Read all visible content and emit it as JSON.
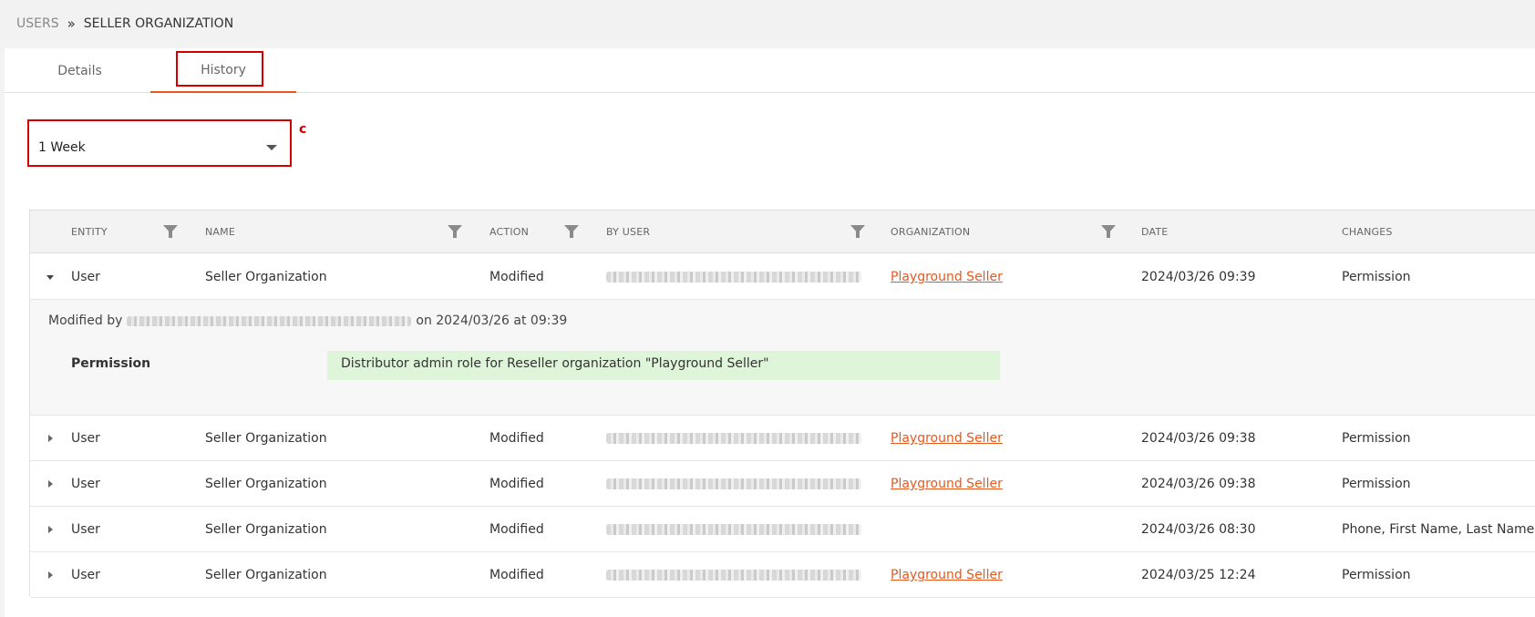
{
  "breadcrumb": {
    "root": "USERS",
    "separator": "»",
    "current": "SELLER ORGANIZATION"
  },
  "tabs": [
    {
      "label": "Details",
      "active": false
    },
    {
      "label": "History",
      "active": true
    }
  ],
  "period_select": {
    "value": "1 Week"
  },
  "annotation_label": "c",
  "grid": {
    "columns": [
      "ENTITY",
      "NAME",
      "ACTION",
      "BY USER",
      "ORGANIZATION",
      "DATE",
      "CHANGES"
    ],
    "rows": [
      {
        "entity": "User",
        "name": "Seller Organization",
        "action": "Modified",
        "organization": "Playground Seller",
        "date": "2024/03/26 09:39",
        "changes": "Permission",
        "expanded": true
      },
      {
        "entity": "User",
        "name": "Seller Organization",
        "action": "Modified",
        "organization": "Playground Seller",
        "date": "2024/03/26 09:38",
        "changes": "Permission",
        "expanded": false
      },
      {
        "entity": "User",
        "name": "Seller Organization",
        "action": "Modified",
        "organization": "Playground Seller",
        "date": "2024/03/26 09:38",
        "changes": "Permission",
        "expanded": false
      },
      {
        "entity": "User",
        "name": "Seller Organization",
        "action": "Modified",
        "organization": "",
        "date": "2024/03/26 08:30",
        "changes": "Phone, First Name, Last Name",
        "expanded": false
      },
      {
        "entity": "User",
        "name": "Seller Organization",
        "action": "Modified",
        "organization": "Playground Seller",
        "date": "2024/03/25 12:24",
        "changes": "Permission",
        "expanded": false
      }
    ],
    "detail": {
      "prefix": "Modified by",
      "suffix": "on 2024/03/26 at 09:39",
      "field_label": "Permission",
      "field_value": "Distributor admin role for Reseller organization \"Playground Seller\""
    }
  },
  "colors": {
    "accent": "#e8581c",
    "highlight_box": "#d40000",
    "change_bg": "#dff5da"
  }
}
